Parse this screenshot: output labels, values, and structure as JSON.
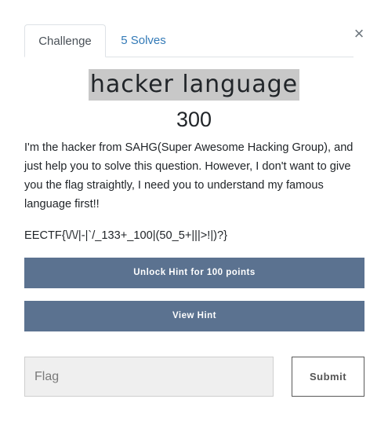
{
  "tabs": [
    {
      "label": "Challenge"
    },
    {
      "label": "5 Solves"
    }
  ],
  "close_icon": "×",
  "challenge": {
    "name": "hacker language",
    "value": "300",
    "description": "I'm the hacker from SAHG(Super Awesome Hacking Group), and just help you to solve this question. However, I don't want to give you the flag straightly, I need you to understand my famous language first!!",
    "flag_text": "EECTF{\\/\\/|-|`/_133+_100|(50_5+|||>!|)?}"
  },
  "hints": {
    "unlock_label": "Unlock Hint for 100 points",
    "view_label": "View Hint"
  },
  "submission": {
    "placeholder": "Flag",
    "value": "",
    "submit_label": "Submit"
  },
  "colors": {
    "hint_button": "#5b7290",
    "link": "#337ab7",
    "title_highlight": "#c8c8c8"
  }
}
